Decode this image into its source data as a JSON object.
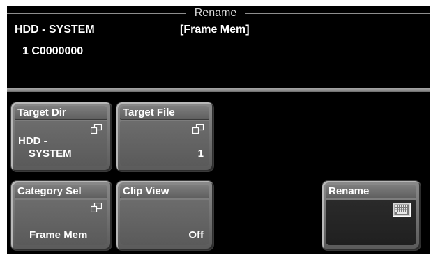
{
  "window": {
    "title": "Rename"
  },
  "info": {
    "device": "HDD - SYSTEM",
    "category": "[Frame Mem]",
    "item": "1 C0000000"
  },
  "buttons": {
    "target_dir": {
      "label": "Target Dir",
      "value_line1": "HDD -",
      "value_line2": "SYSTEM",
      "icon": "popup-window-icon"
    },
    "target_file": {
      "label": "Target File",
      "value": "1",
      "icon": "popup-window-icon"
    },
    "category_sel": {
      "label": "Category Sel",
      "value": "Frame Mem",
      "icon": "popup-window-icon"
    },
    "clip_view": {
      "label": "Clip View",
      "value": "Off"
    },
    "rename": {
      "label": "Rename",
      "icon": "keyboard-icon"
    }
  }
}
